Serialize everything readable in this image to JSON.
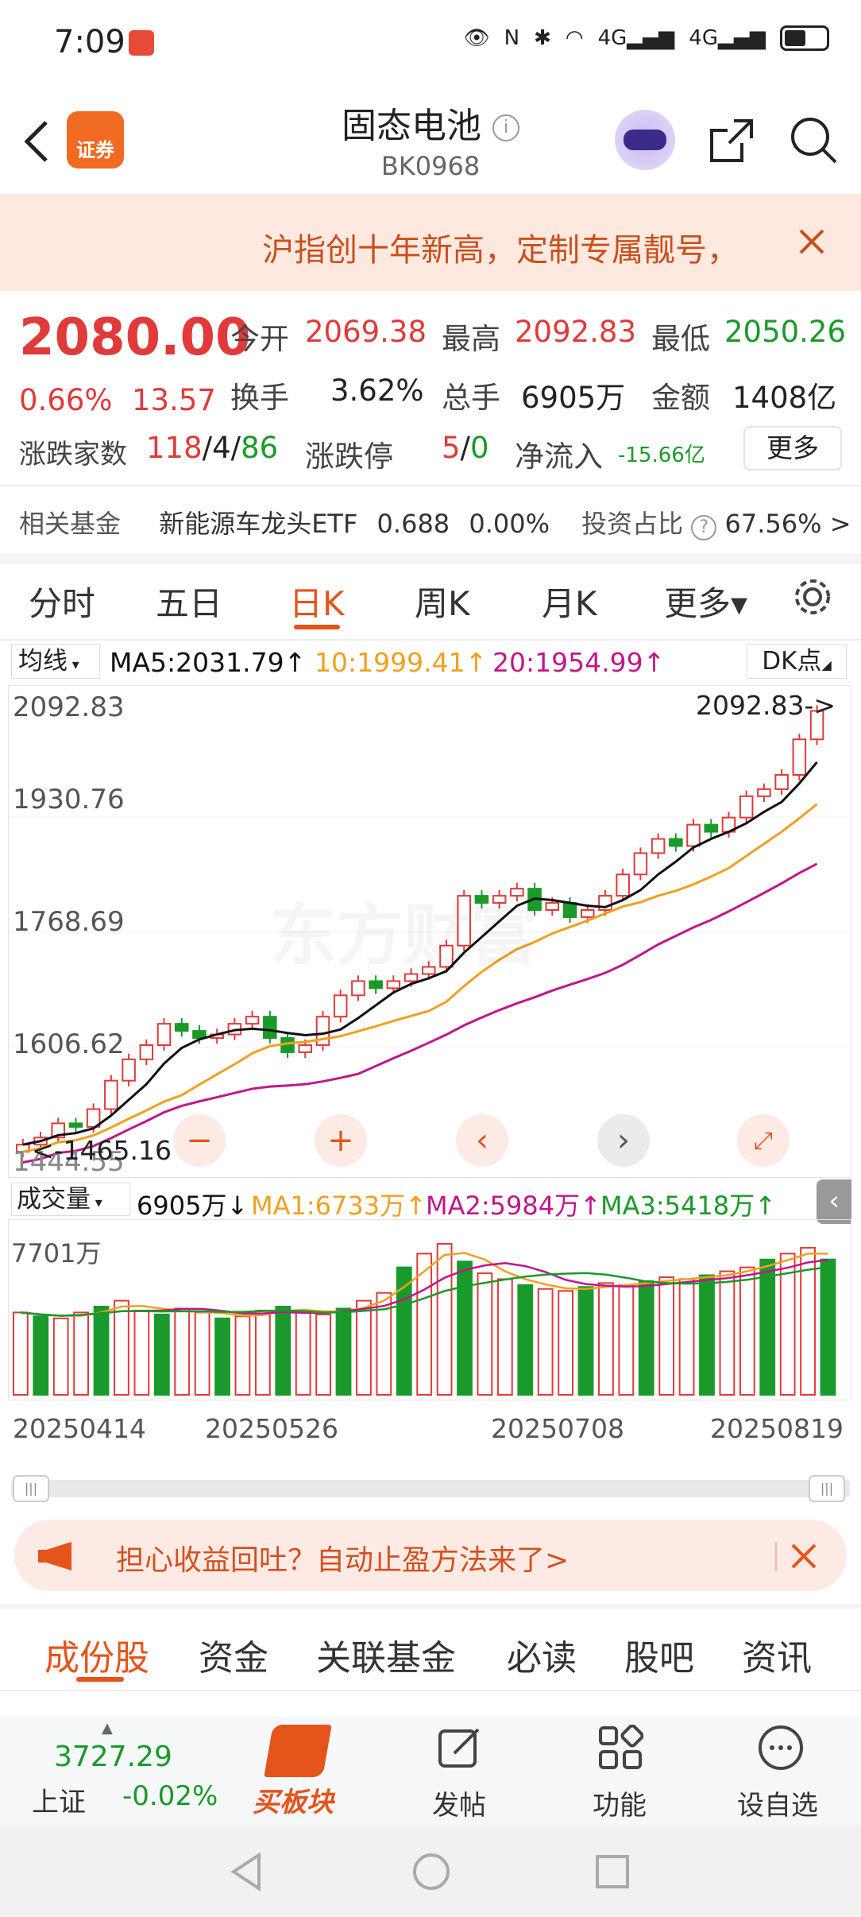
{
  "status_bar": {
    "time": "7:09",
    "signal1": "4G",
    "signal2": "4G"
  },
  "header": {
    "title": "固态电池",
    "code": "BK0968",
    "app_badge": "证券"
  },
  "banner": {
    "text": "沪指创十年新高，定制专属靓号，"
  },
  "quote": {
    "price": "2080.00",
    "change_pct": "0.66%",
    "change": "13.57",
    "open_label": "今开",
    "open": "2069.38",
    "high_label": "最高",
    "high": "2092.83",
    "low_label": "最低",
    "low": "2050.26",
    "turnover_label": "换手",
    "turnover": "3.62%",
    "volume_label": "总手",
    "volume": "6905万",
    "amount_label": "金额",
    "amount": "1408亿",
    "updown_label": "涨跌家数",
    "up": "118",
    "sep1": "/",
    "flat": "4",
    "sep2": "/",
    "down": "86",
    "limit_label": "涨跌停",
    "limit_up": "5",
    "sep3": "/",
    "limit_down": "0",
    "netflow_label": "净流入",
    "netflow": "-15.66亿",
    "more": "更多"
  },
  "fund": {
    "label": "相关基金",
    "name": "新能源车龙头ETF",
    "price": "0.688",
    "pct": "0.00%",
    "ratio_label": "投资占比",
    "ratio": "67.56% >"
  },
  "period_tabs": [
    "分时",
    "五日",
    "日K",
    "周K",
    "月K",
    "更多▾"
  ],
  "ma": {
    "selector": "均线",
    "ma5": "MA5:2031.79↑",
    "ma10": "10:1999.41↑",
    "ma20": "20:1954.99↑",
    "dk": "DK点"
  },
  "chart_axis": {
    "y1": "2092.83",
    "y2": "1930.76",
    "y3": "1768.69",
    "y4": "1606.62",
    "y5": "1444.55",
    "high_mark": "2092.83->",
    "low_mark": "<-1465.16"
  },
  "volume": {
    "selector": "成交量",
    "value": "6905万↓",
    "ma1": "MA1:6733万↑",
    "ma2": "MA2:5984万↑",
    "ma3": "MA3:5418万↑",
    "max_label": "7701万"
  },
  "dates": [
    "20250414",
    "20250526",
    "20250708",
    "20250819"
  ],
  "promo": {
    "text": "担心收益回吐？自动止盈方法来了>"
  },
  "section_tabs": [
    "成份股",
    "资金",
    "关联基金",
    "必读",
    "股吧",
    "资讯"
  ],
  "bottom_nav": {
    "index_value": "3727.29",
    "index_name": "上证",
    "index_pct": "-0.02%",
    "buy": "买板块",
    "post": "发帖",
    "func": "功能",
    "watch": "设自选"
  },
  "colors": {
    "up": "#e03a3a",
    "down": "#1a9a2a",
    "accent": "#e5541a",
    "ma5": "#111111",
    "ma10": "#f0a020",
    "ma20": "#c0178a"
  },
  "chart_data": {
    "type": "candlestick",
    "closes": [
      1470,
      1480,
      1500,
      1495,
      1520,
      1560,
      1590,
      1610,
      1640,
      1630,
      1620,
      1625,
      1640,
      1650,
      1620,
      1600,
      1610,
      1650,
      1680,
      1700,
      1690,
      1700,
      1710,
      1720,
      1750,
      1820,
      1810,
      1820,
      1830,
      1800,
      1810,
      1790,
      1800,
      1820,
      1850,
      1880,
      1900,
      1890,
      1920,
      1910,
      1930,
      1960,
      1970,
      1990,
      2040,
      2080
    ],
    "ylim": [
      1444.55,
      2092.83
    ],
    "volumes": [
      4200,
      4000,
      3900,
      4200,
      4500,
      4800,
      4300,
      4100,
      4400,
      4200,
      3900,
      4000,
      4300,
      4500,
      4200,
      4100,
      4400,
      4800,
      5200,
      6500,
      7200,
      7701,
      6800,
      6200,
      5900,
      5600,
      5400,
      5300,
      5500,
      5700,
      5600,
      5800,
      6000,
      5900,
      6100,
      6300,
      6500,
      6900,
      7200,
      7500,
      6905
    ]
  }
}
